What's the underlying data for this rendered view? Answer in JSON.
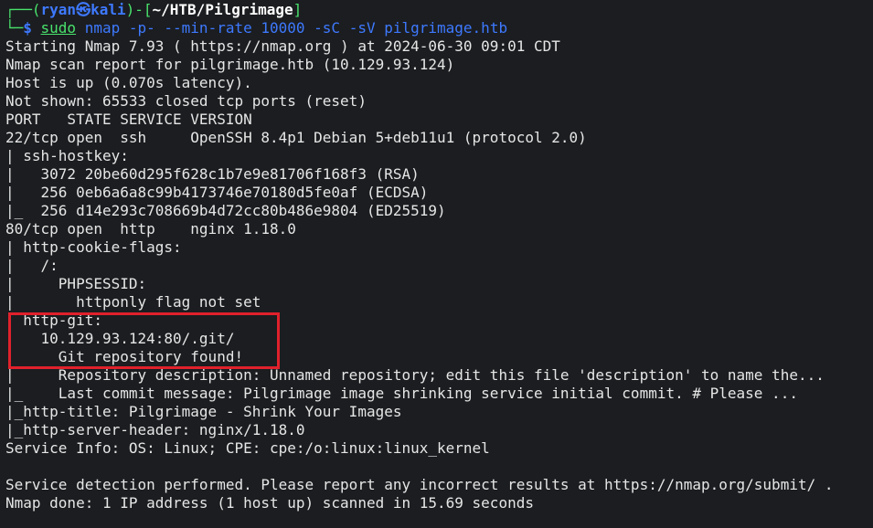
{
  "prompt": {
    "corner_top": "┌──(",
    "user": "ryan",
    "at": "㉿",
    "host": "kali",
    "mid": ")-[",
    "cwd": "~/HTB/Pilgrimage",
    "close": "]",
    "corner_bottom": "└─",
    "dollar": "$ "
  },
  "command": {
    "sudo": "sudo",
    "nmap": "nmap",
    "args": " -p- --min-rate 10000 -sC -sV pilgrimage.htb"
  },
  "output": [
    "Starting Nmap 7.93 ( https://nmap.org ) at 2024-06-30 09:01 CDT",
    "Nmap scan report for pilgrimage.htb (10.129.93.124)",
    "Host is up (0.070s latency).",
    "Not shown: 65533 closed tcp ports (reset)",
    "PORT   STATE SERVICE VERSION",
    "22/tcp open  ssh     OpenSSH 8.4p1 Debian 5+deb11u1 (protocol 2.0)",
    "| ssh-hostkey: ",
    "|   3072 20be60d295f628c1b7e9e81706f168f3 (RSA)",
    "|   256 0eb6a6a8c99b4173746e70180d5fe0af (ECDSA)",
    "|_  256 d14e293c708669b4d72cc80b486e9804 (ED25519)",
    "80/tcp open  http    nginx 1.18.0",
    "| http-cookie-flags: ",
    "|   /: ",
    "|     PHPSESSID: ",
    "|       httponly flag not set",
    "| http-git: ",
    "|   10.129.93.124:80/.git/",
    "|     Git repository found!",
    "|     Repository description: Unnamed repository; edit this file 'description' to name the...",
    "|_    Last commit message: Pilgrimage image shrinking service initial commit. # Please ...",
    "|_http-title: Pilgrimage - Shrink Your Images",
    "|_http-server-header: nginx/1.18.0",
    "Service Info: OS: Linux; CPE: cpe:/o:linux:linux_kernel",
    "",
    "Service detection performed. Please report any incorrect results at https://nmap.org/submit/ .",
    "Nmap done: 1 IP address (1 host up) scanned in 15.69 seconds"
  ],
  "colors": {
    "background": "#1b1d20",
    "prompt_blue": "#3e79ff",
    "command_green": "#49e26c",
    "text": "#e6e6e6",
    "highlight_red": "#e0212c"
  }
}
